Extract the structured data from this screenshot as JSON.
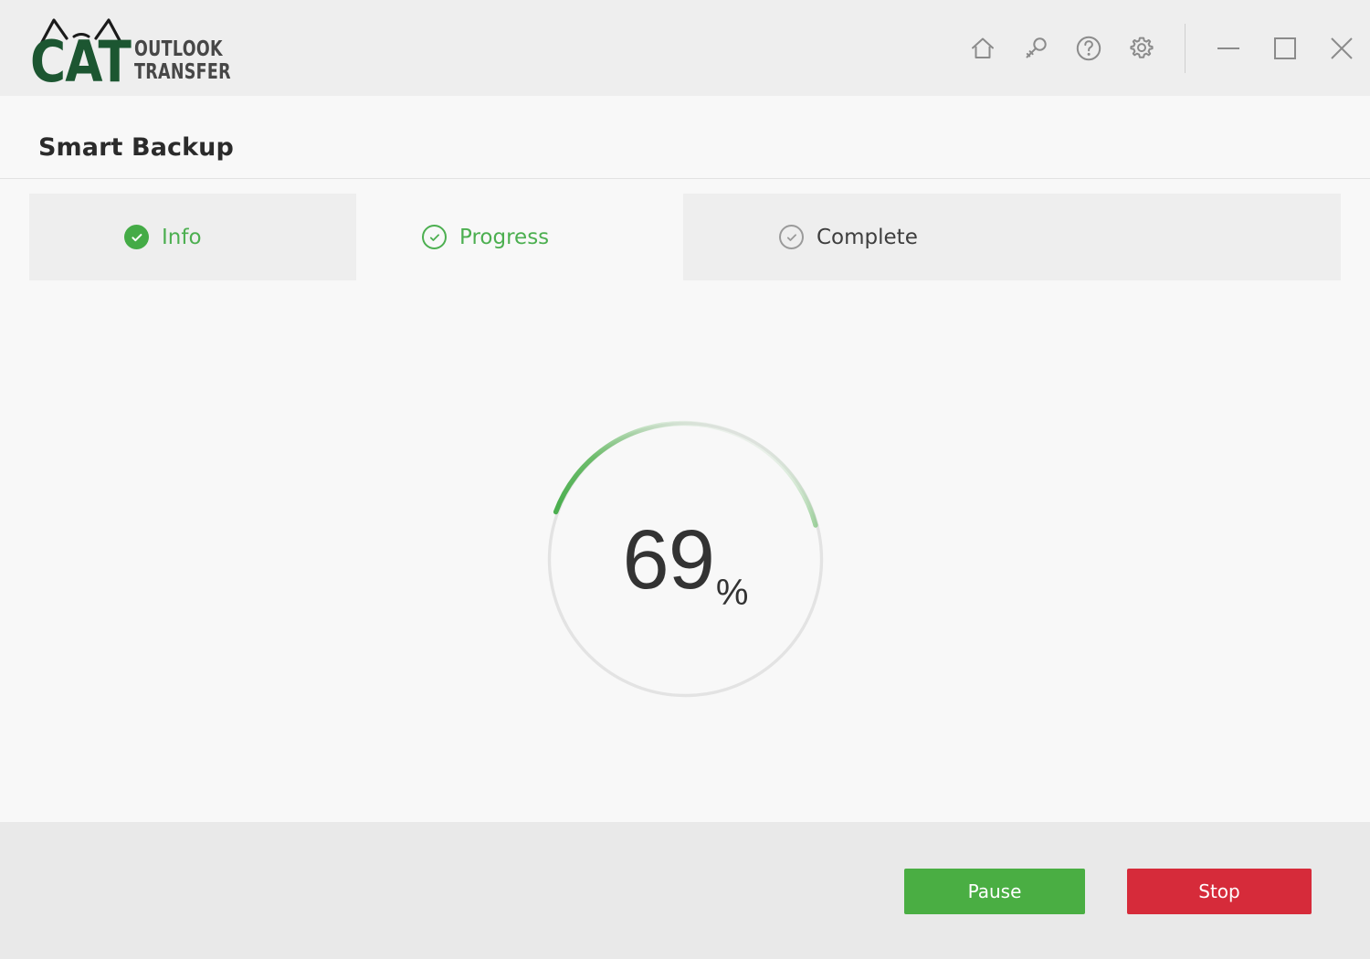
{
  "brand": {
    "name_primary": "CAT",
    "name_secondary_line1": "OUTLOOK",
    "name_secondary_line2": "TRANSFER",
    "primary_color": "#1c5631",
    "secondary_color": "#474747"
  },
  "titlebar": {
    "icons": [
      {
        "name": "home-icon",
        "label": "Home"
      },
      {
        "name": "key-icon",
        "label": "Registration"
      },
      {
        "name": "help-icon",
        "label": "Help"
      },
      {
        "name": "gear-icon",
        "label": "Settings"
      }
    ],
    "window_controls": [
      {
        "name": "minimize-button",
        "label": "Minimize"
      },
      {
        "name": "maximize-button",
        "label": "Maximize"
      },
      {
        "name": "close-button",
        "label": "Close"
      }
    ]
  },
  "page": {
    "title": "Smart Backup"
  },
  "wizard": {
    "accent_color": "#4caf50",
    "active_index": 1,
    "tabs": [
      {
        "label": "Info",
        "state": "done"
      },
      {
        "label": "Progress",
        "state": "active"
      },
      {
        "label": "Complete",
        "state": "pending"
      }
    ]
  },
  "progress": {
    "percent": 69,
    "percent_label": "69",
    "percent_symbol": "%",
    "arc_color": "#4caf50",
    "track_color": "#e3e3e3"
  },
  "footer": {
    "buttons": [
      {
        "label": "Pause",
        "color": "#4aae43",
        "role": "pause"
      },
      {
        "label": "Stop",
        "color": "#d62b3a",
        "role": "stop"
      }
    ]
  }
}
